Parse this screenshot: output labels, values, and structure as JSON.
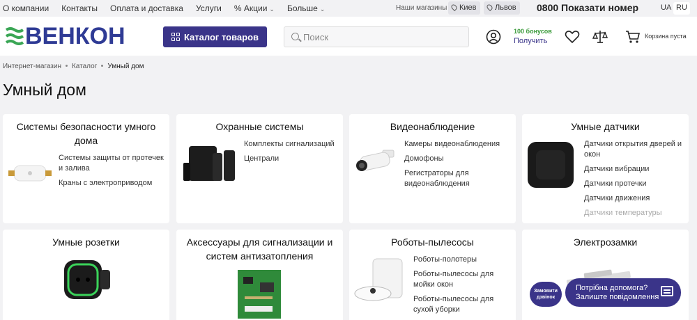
{
  "topbar": {
    "nav": [
      "О компании",
      "Контакты",
      "Оплата и доставка",
      "Услуги",
      "% Акции",
      "Больше"
    ],
    "stores_label": "Наши магазины",
    "cities": [
      "Киев",
      "Львов"
    ],
    "phone": "0800 Показати номер",
    "languages": [
      "UA",
      "RU"
    ],
    "active_language": "RU"
  },
  "header": {
    "logo_text": "ВЕНКОН",
    "catalog_button": "Каталог товаров",
    "search_placeholder": "Поиск",
    "bonus_count": "100 бонусов",
    "bonus_action": "Получить",
    "cart_label": "Корзина пуста"
  },
  "breadcrumb": [
    "Интернет-магазин",
    "Каталог",
    "Умный дом"
  ],
  "page_title": "Умный дом",
  "categories": [
    {
      "title": "Системы безопасности умного дома",
      "links": [
        "Системы защиты от протечек и залива",
        "Краны с электроприводом"
      ]
    },
    {
      "title": "Охранные системы",
      "links": [
        "Комплекты сигнализаций",
        "Централи"
      ]
    },
    {
      "title": "Видеонаблюдение",
      "links": [
        "Камеры видеонаблюдения",
        "Домофоны",
        "Регистраторы для видеонаблюдения"
      ]
    },
    {
      "title": "Умные датчики",
      "links": [
        "Датчики открытия дверей и окон",
        "Датчики вибрации",
        "Датчики протечки",
        "Датчики движения",
        "Датчики температуры"
      ]
    },
    {
      "title": "Умные розетки",
      "links": []
    },
    {
      "title": "Аксессуары для сигнализации и систем антизатопления",
      "links": []
    },
    {
      "title": "Роботы-пылесосы",
      "links": [
        "Роботы-полотеры",
        "Роботы-пылесосы для мойки окон",
        "Роботы-пылесосы для сухой уборки"
      ]
    },
    {
      "title": "Электрозамки",
      "links": []
    }
  ],
  "widget": {
    "callback": "Замовити дзвінок",
    "help_line1": "Потрібна допомога?",
    "help_line2": "Залиште повідомлення"
  },
  "colors": {
    "brand": "#3a3489",
    "logo_green": "#3aa655",
    "background": "#f2f2f4"
  }
}
